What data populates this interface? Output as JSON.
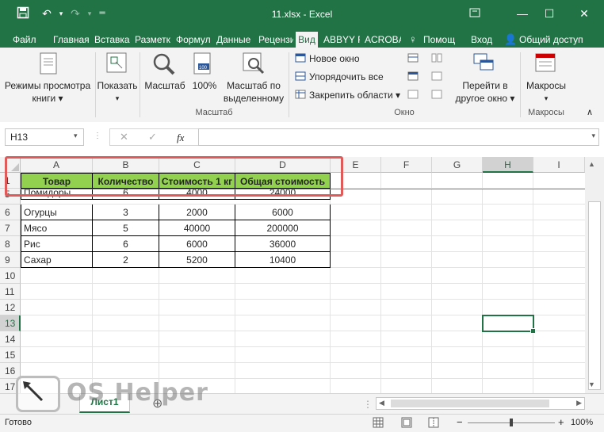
{
  "window": {
    "title": "11.xlsx - Excel"
  },
  "tabs": [
    "Файл",
    "Главная",
    "Вставка",
    "Разметк",
    "Формул",
    "Данные",
    "Рецензи",
    "Вид",
    "ABBYY F",
    "ACROBA",
    "Помощ",
    "Вход",
    "Общий доступ"
  ],
  "ribbon": {
    "view_modes": "Режимы просмотра",
    "view_modes2": "книги",
    "show": "Показать",
    "zoom": "Масштаб",
    "zoom100": "100%",
    "zoom_sel1": "Масштаб по",
    "zoom_sel2": "выделенному",
    "group_zoom": "Масштаб",
    "new_window": "Новое окно",
    "arrange_all": "Упорядочить все",
    "freeze": "Закрепить области",
    "switch1": "Перейти в",
    "switch2": "другое окно",
    "group_window": "Окно",
    "macros": "Макросы",
    "group_macros": "Макросы"
  },
  "formula_bar": {
    "name_box": "H13",
    "fx": "fx",
    "value": ""
  },
  "columns": [
    "A",
    "B",
    "C",
    "D",
    "E",
    "F",
    "G",
    "H",
    "I"
  ],
  "rows": [
    "1",
    "5",
    "6",
    "7",
    "8",
    "9",
    "10",
    "11",
    "12",
    "13",
    "14",
    "15",
    "16",
    "17"
  ],
  "table": {
    "headers": [
      "Товар",
      "Количество",
      "Стоимость 1 кг",
      "Общая стоимость"
    ],
    "data": [
      [
        "Помидоры",
        "6",
        "4000",
        "24000"
      ],
      [
        "Огурцы",
        "3",
        "2000",
        "6000"
      ],
      [
        "Мясо",
        "5",
        "40000",
        "200000"
      ],
      [
        "Рис",
        "6",
        "6000",
        "36000"
      ],
      [
        "Сахар",
        "2",
        "5200",
        "10400"
      ]
    ]
  },
  "sheet_tab": "Лист1",
  "status": {
    "ready": "Готово",
    "zoom": "100%"
  },
  "watermark": "OS Helper",
  "colors": {
    "excel_green": "#217346",
    "header_fill": "#92d050",
    "highlight": "#e05a5a"
  }
}
